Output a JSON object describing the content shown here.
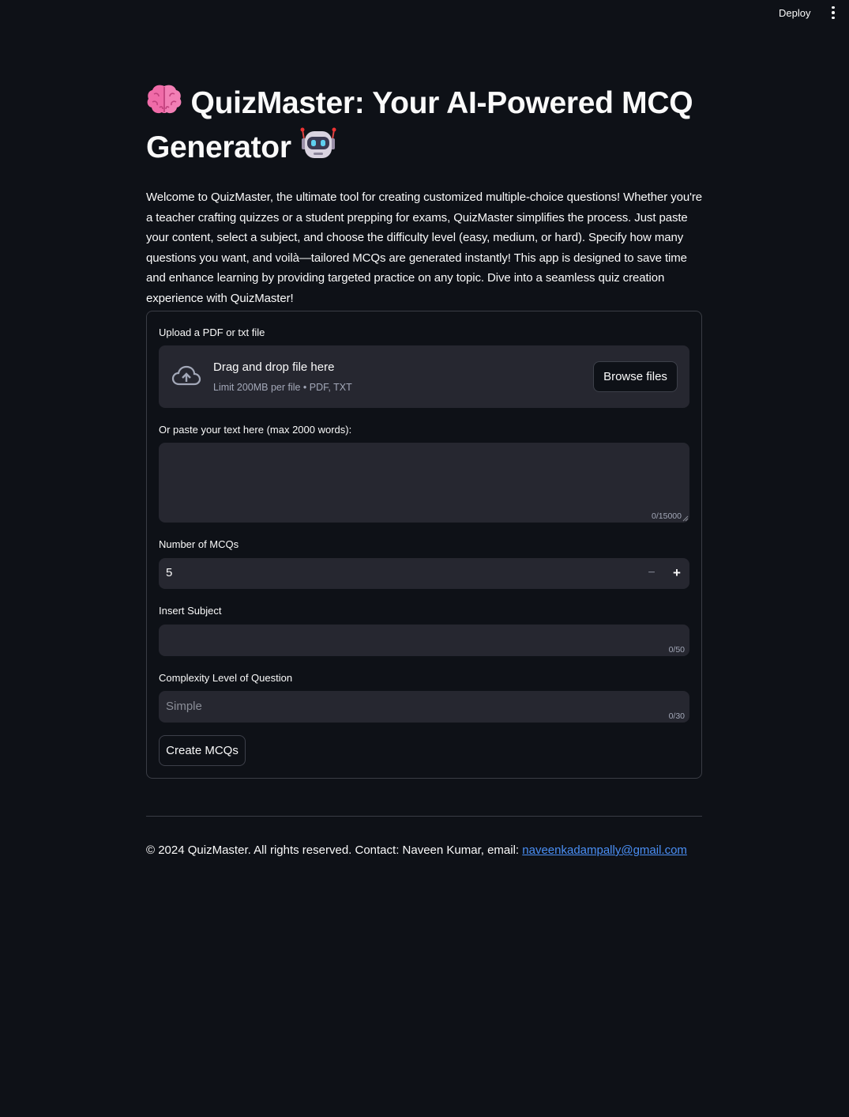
{
  "header": {
    "deploy_label": "Deploy",
    "menu_icon": "kebab-menu-icon"
  },
  "main": {
    "title_emoji_left": "🧠",
    "title_text": "QuizMaster: Your AI-Powered MCQ Generator",
    "title_emoji_right": "🤖",
    "intro": "Welcome to QuizMaster, the ultimate tool for creating customized multiple-choice questions! Whether you're a teacher crafting quizzes or a student prepping for exams, QuizMaster simplifies the process. Just paste your content, select a subject, and choose the difficulty level (easy, medium, or hard). Specify how many questions you want, and voilà—tailored MCQs are generated instantly! This app is designed to save time and enhance learning by providing targeted practice on any topic. Dive into a seamless quiz creation experience with QuizMaster!"
  },
  "form": {
    "upload": {
      "label": "Upload a PDF or txt file",
      "drop_title": "Drag and drop file here",
      "drop_subtitle": "Limit 200MB per file • PDF, TXT",
      "browse_label": "Browse files",
      "icon": "cloud-upload-icon"
    },
    "paste": {
      "label": "Or paste your text here (max 2000 words):",
      "value": "",
      "counter": "0/15000"
    },
    "num_mcqs": {
      "label": "Number of MCQs",
      "value": "5",
      "minus": "−",
      "plus": "+"
    },
    "subject": {
      "label": "Insert Subject",
      "value": "",
      "counter": "0/50"
    },
    "complexity": {
      "label": "Complexity Level of Question",
      "placeholder": "Simple",
      "counter": "0/30"
    },
    "submit_label": "Create MCQs"
  },
  "footer": {
    "text": "© 2024 QuizMaster. All rights reserved. Contact: Naveen Kumar, email: ",
    "email": "naveenkadampally@gmail.com"
  },
  "colors": {
    "background": "#0e1117",
    "input_bg": "#262730",
    "text": "#fafafa",
    "link": "#4a8ff5",
    "border": "#3a3d45"
  }
}
